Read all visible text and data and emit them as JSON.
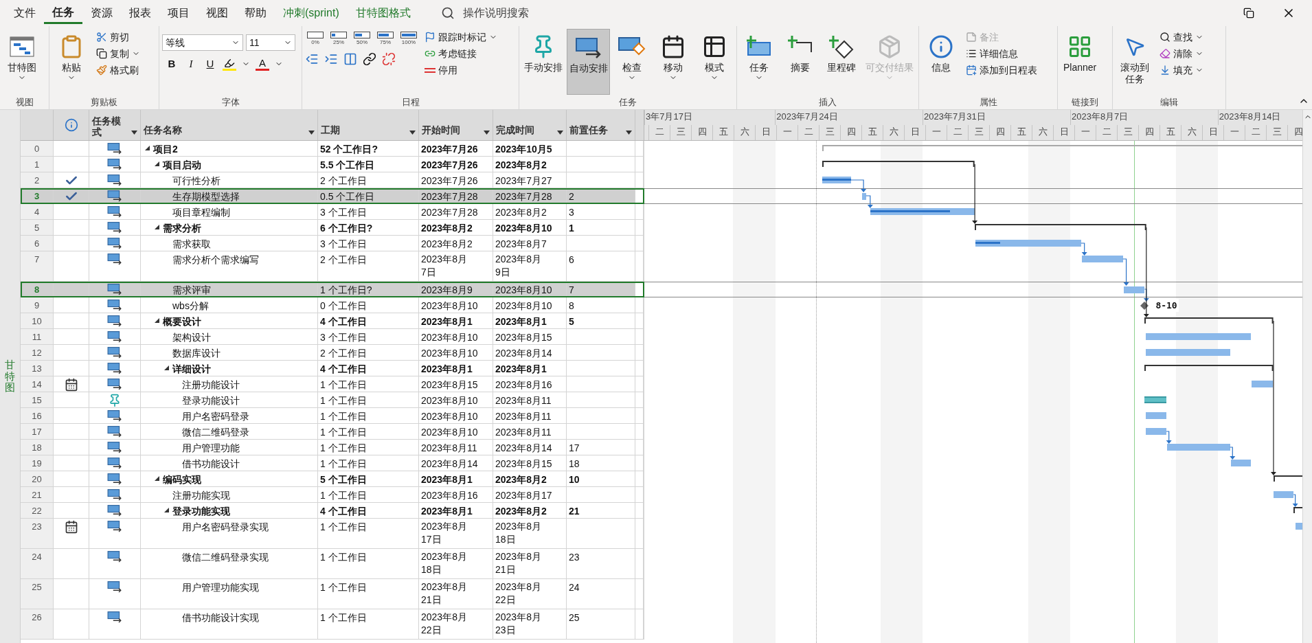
{
  "menu_tabs": [
    {
      "label": "文件",
      "selected": false,
      "kind": "normal"
    },
    {
      "label": "任务",
      "selected": true,
      "kind": "normal"
    },
    {
      "label": "资源",
      "selected": false,
      "kind": "normal"
    },
    {
      "label": "报表",
      "selected": false,
      "kind": "normal"
    },
    {
      "label": "项目",
      "selected": false,
      "kind": "normal"
    },
    {
      "label": "视图",
      "selected": false,
      "kind": "normal"
    },
    {
      "label": "帮助",
      "selected": false,
      "kind": "normal"
    },
    {
      "label": "冲刺(sprint)",
      "selected": false,
      "kind": "contextual"
    },
    {
      "label": "甘特图格式",
      "selected": false,
      "kind": "contextual"
    }
  ],
  "search": {
    "placeholder": "操作说明搜索"
  },
  "ribbon": {
    "view": {
      "label": "视图",
      "gantt": "甘特图"
    },
    "clipboard": {
      "label": "剪贴板",
      "paste": "粘贴",
      "cut": "剪切",
      "copy": "复制",
      "format_painter": "格式刷"
    },
    "font": {
      "label": "字体",
      "family": "等线",
      "size": "11",
      "bold": "B",
      "italic": "I",
      "underline": "U",
      "font_color": "A"
    },
    "schedule": {
      "label": "日程",
      "percents": [
        "0%",
        "25%",
        "50%",
        "75%",
        "100%"
      ],
      "track": "跟踪时标记",
      "respect_links": "考虑链接",
      "inactivate": "停用"
    },
    "tasks": {
      "label": "任务",
      "manual": {
        "label": "手动安排",
        "selected": false
      },
      "auto": {
        "label": "自动安排",
        "selected": true
      },
      "inspect": "检查",
      "move": "移动",
      "mode": "模式"
    },
    "insert": {
      "label": "插入",
      "task": "任务",
      "summary": "摘要",
      "milestone": "里程碑",
      "deliverable": {
        "label": "可交付结果",
        "disabled": true
      }
    },
    "properties": {
      "label": "属性",
      "info": "信息",
      "notes": {
        "label": "备注",
        "disabled": true
      },
      "details": "详细信息",
      "add_timeline": "添加到日程表"
    },
    "link": {
      "label": "链接到",
      "planner": "Planner"
    },
    "editing": {
      "label": "编辑",
      "scroll": "滚动到任务",
      "find": "查找",
      "clear": "清除",
      "fill": "填充"
    }
  },
  "side_label": "甘特图",
  "table": {
    "columns": [
      "任务模式",
      "任务名称",
      "工期",
      "开始时间",
      "完成时间",
      "前置任务"
    ],
    "tasks": [
      {
        "num": "0",
        "name": "项目2",
        "duration": "52 个工作日?",
        "start": "2023年7月26",
        "finish": "2023年10月5",
        "manual": false,
        "completed": false,
        "constraint": false,
        "wrapped": false,
        "selected": false,
        "expanded": true,
        "children": [
          {
            "num": "1",
            "name": "项目启动",
            "duration": "5.5 个工作日",
            "start": "2023年7月26",
            "finish": "2023年8月2",
            "manual": false,
            "completed": false,
            "constraint": false,
            "wrapped": false,
            "selected": false,
            "expanded": true,
            "children": [
              {
                "num": "2",
                "name": "可行性分析",
                "duration": "2 个工作日",
                "start": "2023年7月26",
                "finish": "2023年7月27",
                "manual": false,
                "completed": true,
                "constraint": false,
                "wrapped": false,
                "selected": false,
                "level": 1
              },
              {
                "num": "3",
                "name": "生存期模型选择",
                "duration": "0.5 个工作日",
                "start": "2023年7月28",
                "finish": "2023年7月28",
                "predecessors": "2",
                "manual": false,
                "completed": true,
                "constraint": false,
                "wrapped": false,
                "selected": true
              },
              {
                "num": "4",
                "name": "项目章程编制",
                "duration": "3 个工作日",
                "start": "2023年7月28",
                "finish": "2023年8月2",
                "predecessors": "3",
                "manual": false,
                "completed": false,
                "constraint": false,
                "wrapped": false,
                "selected": false,
                "level": 0.76
              }
            ]
          },
          {
            "num": "5",
            "name": "需求分析",
            "duration": "6 个工作日?",
            "start": "2023年8月2",
            "finish": "2023年8月10",
            "predecessors": "1",
            "manual": false,
            "completed": false,
            "constraint": false,
            "wrapped": false,
            "selected": false,
            "expanded": true,
            "children": [
              {
                "num": "6",
                "name": "需求获取",
                "duration": "3 个工作日",
                "start": "2023年8月2",
                "finish": "2023年8月7",
                "manual": false,
                "completed": false,
                "constraint": false,
                "wrapped": false,
                "selected": false,
                "level": 0.23
              },
              {
                "num": "7",
                "name": "需求分析个需求编写",
                "duration": "2 个工作日",
                "start": "2023年8月\n7日",
                "finish": "2023年8月\n9日",
                "predecessors": "6",
                "manual": false,
                "completed": false,
                "constraint": false,
                "wrapped": true,
                "selected": false
              },
              {
                "num": "8",
                "name": "需求评审",
                "duration": "1 个工作日?",
                "start": "2023年8月9",
                "finish": "2023年8月10",
                "predecessors": "7",
                "manual": false,
                "completed": false,
                "constraint": false,
                "wrapped": false,
                "selected": true
              },
              {
                "num": "9",
                "name": "wbs分解",
                "duration": "0 个工作日",
                "start": "2023年8月10",
                "finish": "2023年8月10",
                "predecessors": "8",
                "manual": false,
                "completed": false,
                "constraint": false,
                "wrapped": false,
                "selected": false,
                "bar_label": "8-10"
              }
            ]
          },
          {
            "num": "10",
            "name": "概要设计",
            "duration": "4 个工作日",
            "start": "2023年8月1",
            "finish": "2023年8月1",
            "predecessors": "5",
            "manual": false,
            "completed": false,
            "constraint": false,
            "wrapped": false,
            "selected": false,
            "expanded": true,
            "children": [
              {
                "num": "11",
                "name": "架构设计",
                "duration": "3 个工作日",
                "start": "2023年8月10",
                "finish": "2023年8月15",
                "manual": false,
                "completed": false,
                "constraint": false,
                "wrapped": false,
                "selected": false
              },
              {
                "num": "12",
                "name": "数据库设计",
                "duration": "2 个工作日",
                "start": "2023年8月10",
                "finish": "2023年8月14",
                "manual": false,
                "completed": false,
                "constraint": false,
                "wrapped": false,
                "selected": false
              },
              {
                "num": "13",
                "name": "详细设计",
                "duration": "4 个工作日",
                "start": "2023年8月1",
                "finish": "2023年8月1",
                "manual": false,
                "completed": false,
                "constraint": false,
                "wrapped": false,
                "selected": false,
                "expanded": true,
                "children": [
                  {
                    "num": "14",
                    "name": "注册功能设计",
                    "duration": "1 个工作日",
                    "start": "2023年8月15",
                    "finish": "2023年8月16",
                    "manual": false,
                    "completed": false,
                    "constraint": true,
                    "wrapped": false,
                    "selected": false
                  },
                  {
                    "num": "15",
                    "name": "登录功能设计",
                    "duration": "1 个工作日",
                    "start": "2023年8月10",
                    "finish": "2023年8月11",
                    "manual": true,
                    "completed": false,
                    "constraint": false,
                    "wrapped": false,
                    "selected": false
                  },
                  {
                    "num": "16",
                    "name": "用户名密码登录",
                    "duration": "1 个工作日",
                    "start": "2023年8月10",
                    "finish": "2023年8月11",
                    "manual": false,
                    "completed": false,
                    "constraint": false,
                    "wrapped": false,
                    "selected": false
                  },
                  {
                    "num": "17",
                    "name": "微信二维码登录",
                    "duration": "1 个工作日",
                    "start": "2023年8月10",
                    "finish": "2023年8月11",
                    "manual": false,
                    "completed": false,
                    "constraint": false,
                    "wrapped": false,
                    "selected": false
                  },
                  {
                    "num": "18",
                    "name": "用户管理功能",
                    "duration": "1 个工作日",
                    "start": "2023年8月11",
                    "finish": "2023年8月14",
                    "predecessors": "17",
                    "manual": false,
                    "completed": false,
                    "constraint": false,
                    "wrapped": false,
                    "selected": false
                  },
                  {
                    "num": "19",
                    "name": "借书功能设计",
                    "duration": "1 个工作日",
                    "start": "2023年8月14",
                    "finish": "2023年8月15",
                    "predecessors": "18",
                    "manual": false,
                    "completed": false,
                    "constraint": false,
                    "wrapped": false,
                    "selected": false
                  }
                ]
              }
            ]
          },
          {
            "num": "20",
            "name": "编码实现",
            "duration": "5 个工作日",
            "start": "2023年8月1",
            "finish": "2023年8月2",
            "predecessors": "10",
            "manual": false,
            "completed": false,
            "constraint": false,
            "wrapped": false,
            "selected": false,
            "expanded": true,
            "children": [
              {
                "num": "21",
                "name": "注册功能实现",
                "duration": "1 个工作日",
                "start": "2023年8月16",
                "finish": "2023年8月17",
                "manual": false,
                "completed": false,
                "constraint": false,
                "wrapped": false,
                "selected": false
              },
              {
                "num": "22",
                "name": "登录功能实现",
                "duration": "4 个工作日",
                "start": "2023年8月1",
                "finish": "2023年8月2",
                "predecessors": "21",
                "manual": false,
                "completed": false,
                "constraint": false,
                "wrapped": false,
                "selected": false,
                "expanded": true,
                "children": [
                  {
                    "num": "23",
                    "name": "用户名密码登录实现",
                    "duration": "1 个工作日",
                    "start": "2023年8月\n17日",
                    "finish": "2023年8月\n18日",
                    "manual": false,
                    "completed": false,
                    "constraint": true,
                    "wrapped": true,
                    "selected": false
                  },
                  {
                    "num": "24",
                    "name": "微信二维码登录实现",
                    "duration": "1 个工作日",
                    "start": "2023年8月\n18日",
                    "finish": "2023年8月\n21日",
                    "predecessors": "23",
                    "manual": false,
                    "completed": false,
                    "constraint": false,
                    "wrapped": true,
                    "selected": false
                  },
                  {
                    "num": "25",
                    "name": "用户管理功能实现",
                    "duration": "1 个工作日",
                    "start": "2023年8月\n21日",
                    "finish": "2023年8月\n22日",
                    "predecessors": "24",
                    "manual": false,
                    "completed": false,
                    "constraint": false,
                    "wrapped": true,
                    "selected": false
                  },
                  {
                    "num": "26",
                    "name": "借书功能设计实现",
                    "duration": "1 个工作日",
                    "start": "2023年8月\n22日",
                    "finish": "2023年8月\n23日",
                    "predecessors": "25",
                    "manual": false,
                    "completed": false,
                    "constraint": false,
                    "wrapped": true,
                    "selected": false
                  }
                ]
              }
            ]
          }
        ]
      }
    ]
  },
  "gantt": {
    "weeks": [
      {
        "label": "3年7月17日",
        "days": [
          "二",
          "三",
          "四",
          "五",
          "六",
          "日"
        ]
      },
      {
        "label": "2023年7月24日",
        "days": [
          "一",
          "二",
          "三",
          "四",
          "五",
          "六",
          "日"
        ]
      },
      {
        "label": "2023年7月31日",
        "days": [
          "一",
          "二",
          "三",
          "四",
          "五",
          "六",
          "日"
        ]
      },
      {
        "label": "2023年8月7日",
        "days": [
          "一",
          "二",
          "三",
          "四",
          "五",
          "六",
          "日"
        ]
      },
      {
        "label": "2023年8月14日",
        "days": [
          "一",
          "二",
          "三",
          "四"
        ]
      }
    ]
  }
}
